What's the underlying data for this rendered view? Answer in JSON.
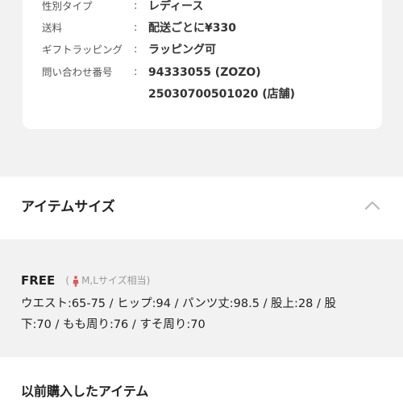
{
  "spec": {
    "rows": [
      {
        "label": "性別タイプ",
        "colon": ":",
        "value": "レディース"
      },
      {
        "label": "送料",
        "colon": ":",
        "value": "配送ごとに¥330"
      },
      {
        "label": "ギフトラッピング",
        "colon": ":",
        "value": "ラッピング可"
      },
      {
        "label": "問い合わせ番号",
        "colon": ":",
        "value": "94333055 (ZOZO)"
      },
      {
        "label": "",
        "colon": "",
        "value": "25030700501020 (店舗)"
      }
    ]
  },
  "item_size": {
    "title": "アイテムサイズ",
    "toggle_icon": "chevron-up-icon",
    "size_name": "FREE",
    "note_open": "(",
    "note_text": "M,Lサイズ相当)",
    "note_icon": "person-icon",
    "note_icon_color": "#e05a5a",
    "measurements_line1": "ウエスト:65-75 / ヒップ:94 / パンツ丈:98.5 / 股上:28 / 股",
    "measurements_line2": "下:70 / もも周り:76 / すそ周り:70"
  },
  "previous": {
    "title": "以前購入したアイテム"
  }
}
